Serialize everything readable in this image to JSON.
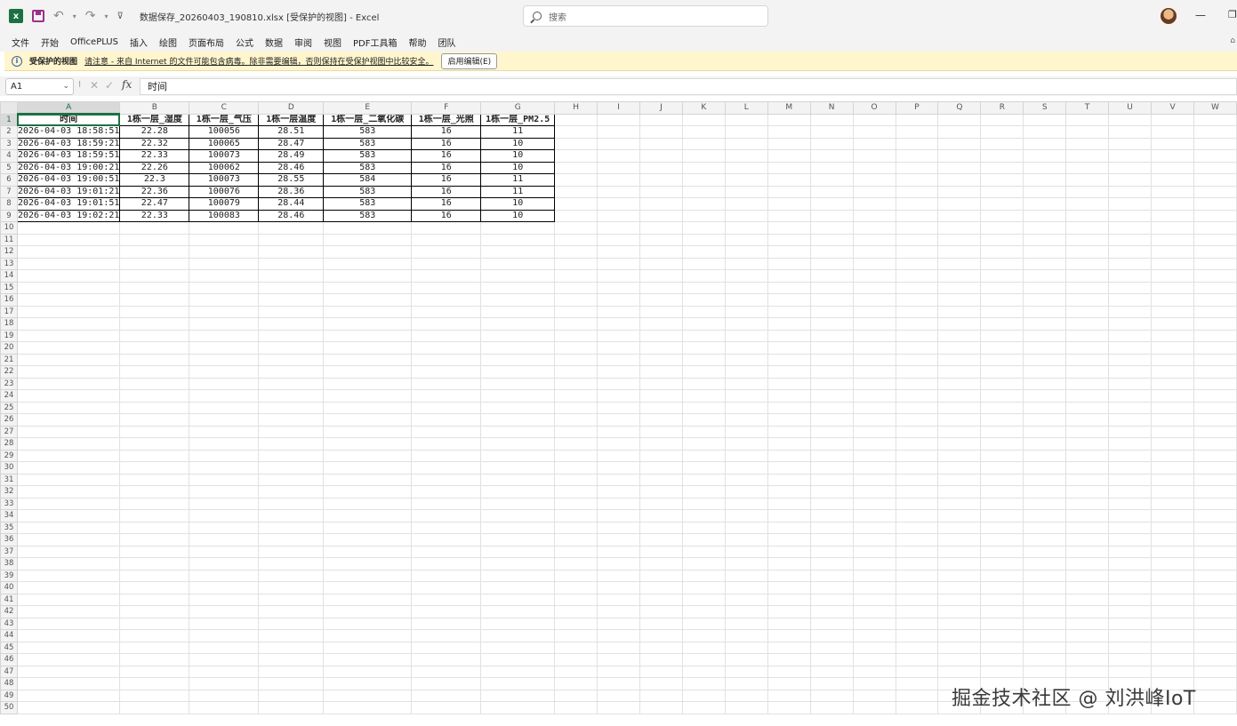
{
  "titlebar": {
    "filename": "数据保存_20260403_190810.xlsx",
    "view_mode": "[受保护的视图]",
    "separator": "-",
    "app": "Excel",
    "search_placeholder": "搜索",
    "qat_more": "⊽"
  },
  "menu": [
    "文件",
    "开始",
    "OfficePLUS",
    "插入",
    "绘图",
    "页面布局",
    "公式",
    "数据",
    "审阅",
    "视图",
    "PDF工具箱",
    "帮助",
    "团队"
  ],
  "protected_view": {
    "title": "受保护的视图",
    "message": "请注意 - 来自 Internet 的文件可能包含病毒。除非需要编辑，否则保持在受保护视图中比较安全。",
    "button": "启用编辑(E)"
  },
  "formula_bar": {
    "name_box": "A1",
    "fx": "fx",
    "content": "时间"
  },
  "sheet": {
    "columns": [
      "A",
      "B",
      "C",
      "D",
      "E",
      "F",
      "G",
      "H",
      "I",
      "J",
      "K",
      "L",
      "M",
      "N",
      "O",
      "P",
      "Q",
      "R",
      "S",
      "T",
      "U",
      "V",
      "W"
    ],
    "headers": [
      "时间",
      "1栋一层_湿度",
      "1栋一层_气压",
      "1栋一层温度",
      "1栋一层_二氧化碳",
      "1栋一层_光照",
      "1栋一层_PM2.5"
    ],
    "rows": [
      [
        "2026-04-03 18:58:51",
        "22.28",
        "100056",
        "28.51",
        "583",
        "16",
        "11"
      ],
      [
        "2026-04-03 18:59:21",
        "22.32",
        "100065",
        "28.47",
        "583",
        "16",
        "10"
      ],
      [
        "2026-04-03 18:59:51",
        "22.33",
        "100073",
        "28.49",
        "583",
        "16",
        "10"
      ],
      [
        "2026-04-03 19:00:21",
        "22.26",
        "100062",
        "28.46",
        "583",
        "16",
        "10"
      ],
      [
        "2026-04-03 19:00:51",
        "22.3",
        "100073",
        "28.55",
        "584",
        "16",
        "11"
      ],
      [
        "2026-04-03 19:01:21",
        "22.36",
        "100076",
        "28.36",
        "583",
        "16",
        "11"
      ],
      [
        "2026-04-03 19:01:51",
        "22.47",
        "100079",
        "28.44",
        "583",
        "16",
        "10"
      ],
      [
        "2026-04-03 19:02:21",
        "22.33",
        "100083",
        "28.46",
        "583",
        "16",
        "10"
      ]
    ],
    "total_rows": 50,
    "selected_cell": "A1"
  },
  "watermark": "掘金技术社区 @ 刘洪峰IoT",
  "colors": {
    "excel_green": "#1d7044",
    "protected_bar": "#fff6ce"
  }
}
